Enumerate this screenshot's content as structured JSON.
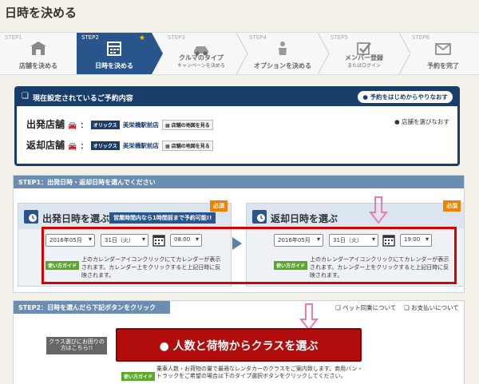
{
  "page_title": "日時を決める",
  "steps": [
    {
      "num": "STEP1",
      "label": "店舗を決める",
      "sub": ""
    },
    {
      "num": "STEP2",
      "label": "日時を決める",
      "sub": ""
    },
    {
      "num": "STEP3",
      "label": "クルマのタイプ",
      "sub": "キャンペーンを決める"
    },
    {
      "num": "STEP4",
      "label": "オプションを決める",
      "sub": ""
    },
    {
      "num": "STEP5",
      "label": "メンバー登録",
      "sub": "またはログイン"
    },
    {
      "num": "STEP6",
      "label": "予約を完了",
      "sub": ""
    }
  ],
  "current": {
    "title": "現在設定されているご予約内容",
    "redo_button": "予約をはじめからやりなおす",
    "choose_store": "店舗を選びなおす",
    "departure_label": "出発店舗",
    "return_label": "返却店舗",
    "brand_tag": "オリックス",
    "departure_store": "美栄橋駅前店",
    "return_store": "美栄橋駅前店",
    "map_link": "店舗の地図を見る"
  },
  "step1_bar": "STEP1：出発日時・返却日時を選んでください",
  "departure": {
    "title": "出発日時を選ぶ",
    "badge": "必須",
    "notice": "営業時間内なら1時間前まで予約可能!!",
    "month": "2016年05月",
    "day": "31日（火）",
    "time": "08:00"
  },
  "return": {
    "title": "返却日時を選ぶ",
    "badge": "必須",
    "month": "2016年05月",
    "day": "31日（火）",
    "time": "19:00"
  },
  "guide_tag": "使い方ガイド",
  "guide_text": "上のカレンダーアイコンクリックにてカレンダーが表示されます。カレンダー上をクリックすると上記日時に反映されます。",
  "step2_bar": "STEP2：日時を選んだら下記ボタンをクリック",
  "pet_link": "ペット同乗について",
  "payment_link": "お支払いについて",
  "class_help_button": "クラス選びにお困りの方はこちら!!",
  "main_button": "人数と荷物からクラスを選ぶ",
  "bottom_guide": "乗車人数・お荷物の量で最適なレンタカーのクラスをご案内致します。商用バン・トラックをご希望の場合は下のタイプ選択ボタンをクリックしてください。"
}
